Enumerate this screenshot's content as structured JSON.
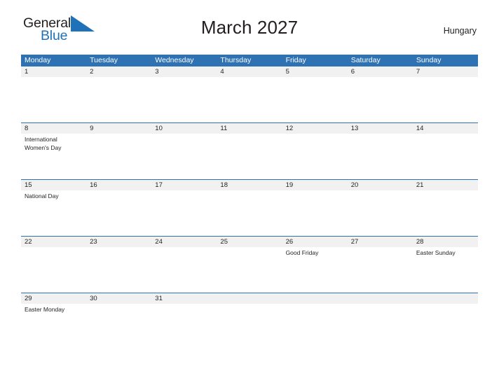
{
  "brand": {
    "name_part1": "General",
    "name_part2": "Blue",
    "triangle_icon": "blue-triangle-icon"
  },
  "header": {
    "title": "March 2027",
    "region": "Hungary"
  },
  "colors": {
    "header_blue": "#2e72b4",
    "date_band": "#f1f1f1",
    "brand_blue": "#1f72b8",
    "text": "#231f20"
  },
  "weekday_headers": [
    "Monday",
    "Tuesday",
    "Wednesday",
    "Thursday",
    "Friday",
    "Saturday",
    "Sunday"
  ],
  "calendar": {
    "month": "March",
    "year": "2027",
    "weeks": [
      {
        "dates": [
          "1",
          "2",
          "3",
          "4",
          "5",
          "6",
          "7"
        ],
        "events": [
          "",
          "",
          "",
          "",
          "",
          "",
          ""
        ]
      },
      {
        "dates": [
          "8",
          "9",
          "10",
          "11",
          "12",
          "13",
          "14"
        ],
        "events": [
          "International Women's Day",
          "",
          "",
          "",
          "",
          "",
          ""
        ]
      },
      {
        "dates": [
          "15",
          "16",
          "17",
          "18",
          "19",
          "20",
          "21"
        ],
        "events": [
          "National Day",
          "",
          "",
          "",
          "",
          "",
          ""
        ]
      },
      {
        "dates": [
          "22",
          "23",
          "24",
          "25",
          "26",
          "27",
          "28"
        ],
        "events": [
          "",
          "",
          "",
          "",
          "Good Friday",
          "",
          "Easter Sunday"
        ]
      },
      {
        "dates": [
          "29",
          "30",
          "31",
          "",
          "",
          "",
          ""
        ],
        "events": [
          "Easter Monday",
          "",
          "",
          "",
          "",
          "",
          ""
        ]
      }
    ]
  }
}
